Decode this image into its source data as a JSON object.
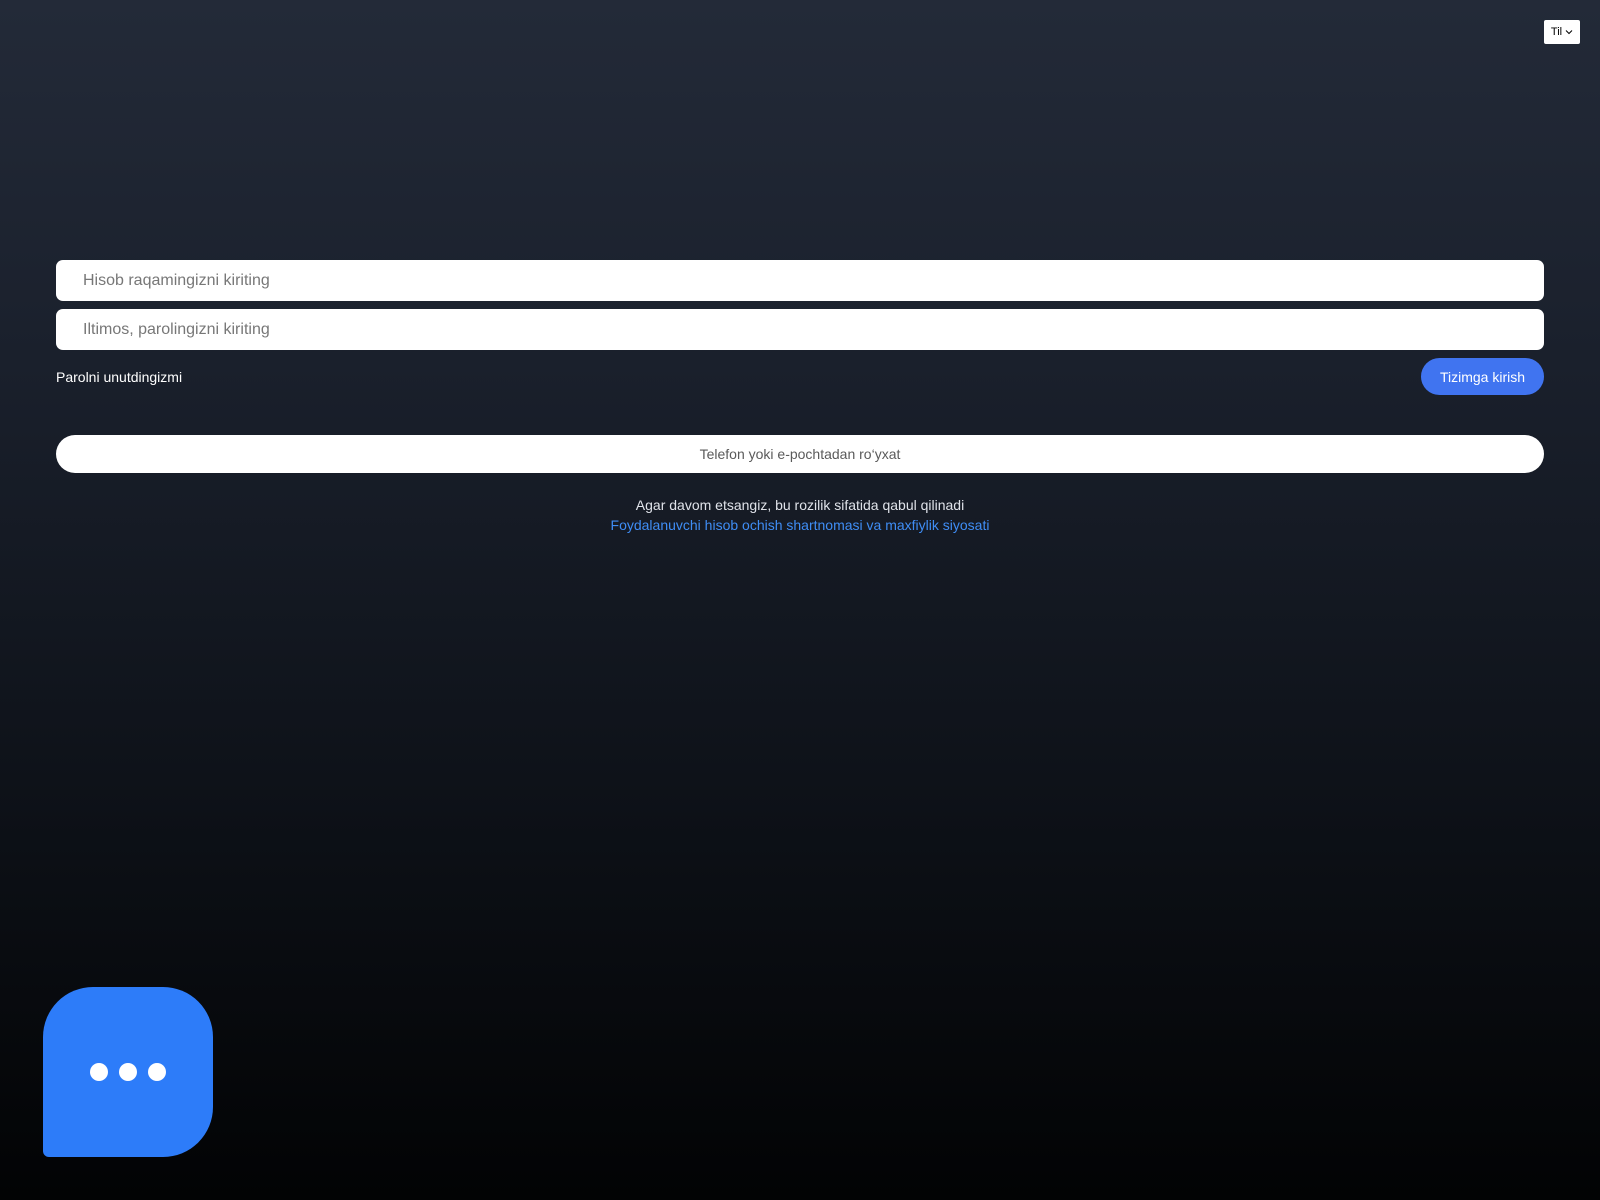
{
  "language_selector": {
    "label": "Til",
    "icon": "chevron-down-icon"
  },
  "login_form": {
    "account_input": {
      "value": "",
      "placeholder": "Hisob raqamingizni kiriting"
    },
    "password_input": {
      "value": "",
      "placeholder": "Iltimos, parolingizni kiriting"
    },
    "forgot_password_label": "Parolni unutdingizmi",
    "login_button_label": "Tizimga kirish",
    "register_button_label": "Telefon yoki e-pochtadan ro‘yxat"
  },
  "terms": {
    "text": "Agar davom etsangiz, bu rozilik sifatida qabul qilinadi",
    "link": "Foydalanuvchi hisob ochish shartnomasi va maxfiylik siyosati"
  },
  "chat_widget": {
    "icon": "chat-dots-icon"
  },
  "colors": {
    "accent": "#4074f0",
    "chat": "#2d7cf9",
    "link": "#3f8df5",
    "background_top": "#232a38",
    "background_bottom": "#020304"
  }
}
